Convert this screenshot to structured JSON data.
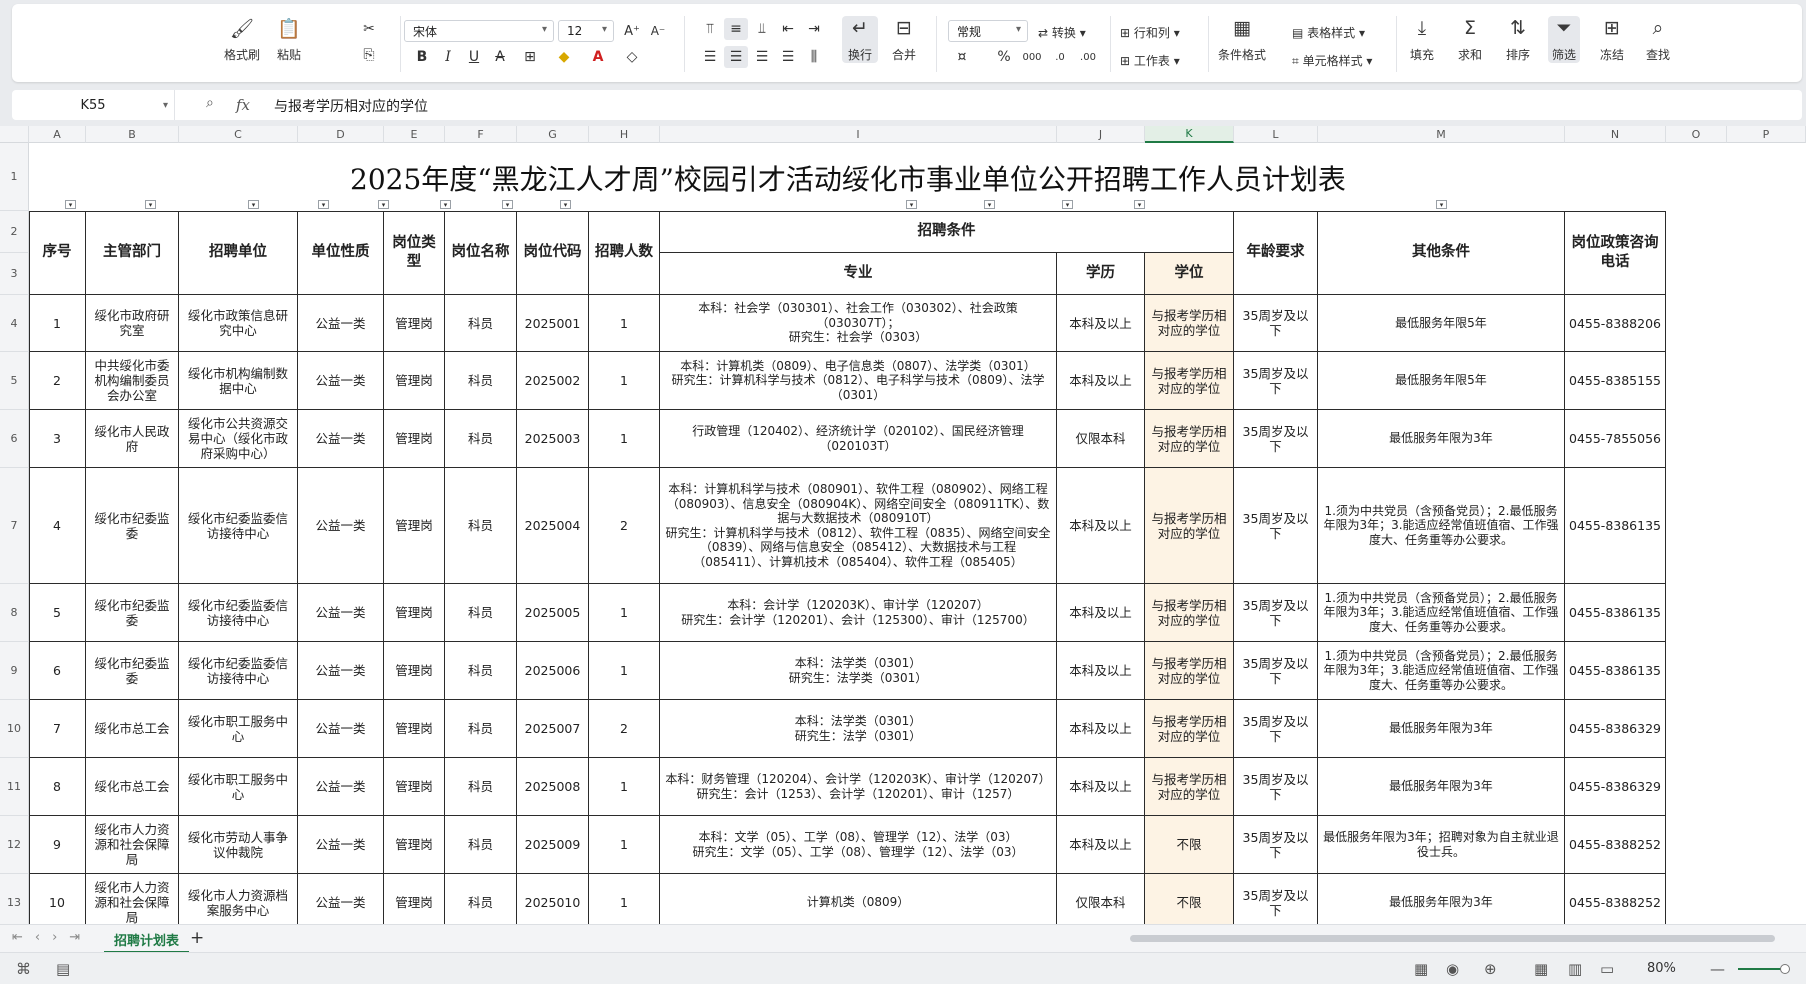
{
  "ribbon": {
    "format_painter": "格式刷",
    "paste": "粘贴",
    "font_name": "宋体",
    "font_size": "12",
    "wrap": "换行",
    "merge": "合并",
    "number_format": "常规",
    "convert": "转换",
    "rows_cols": "行和列",
    "worksheet": "工作表",
    "cond_format": "条件格式",
    "table_style": "表格样式",
    "cell_style": "单元格样式",
    "fill": "填充",
    "sum": "求和",
    "sort": "排序",
    "filter": "筛选",
    "freeze": "冻结",
    "find": "查找"
  },
  "formula_bar": {
    "cell_ref": "K55",
    "fx": "fx",
    "content": "与报考学历相对应的学位"
  },
  "columns": [
    "A",
    "B",
    "C",
    "D",
    "E",
    "F",
    "G",
    "H",
    "I",
    "J",
    "K",
    "L",
    "M",
    "N",
    "O",
    "P"
  ],
  "row_numbers": [
    "1",
    "2",
    "3",
    "4",
    "5",
    "6",
    "7",
    "8",
    "9",
    "10",
    "11",
    "12",
    "13"
  ],
  "title": "2025年度“黑龙江人才周”校园引才活动绥化市事业单位公开招聘工作人员计划表",
  "headers": {
    "seq": "序号",
    "dept": "主管部门",
    "unit": "招聘单位",
    "nature": "单位性质",
    "post_type": "岗位类型",
    "post_name": "岗位名称",
    "post_code": "岗位代码",
    "count": "招聘人数",
    "conditions": "招聘条件",
    "major": "专业",
    "education": "学历",
    "degree": "学位",
    "age": "年龄要求",
    "other": "其他条件",
    "phone": "岗位政策咨询电话"
  },
  "rows": [
    {
      "seq": "1",
      "dept": "绥化市政府研究室",
      "unit": "绥化市政策信息研究中心",
      "nature": "公益一类",
      "type": "管理岗",
      "name": "科员",
      "code": "2025001",
      "count": "1",
      "major": "本科：社会学（030301）、社会工作（030302）、社会政策（030307T）；\n研究生：社会学（0303）",
      "edu": "本科及以上",
      "degree": "与报考学历相对应的学位",
      "age": "35周岁及以下",
      "other": "最低服务年限5年",
      "phone": "0455-8388206"
    },
    {
      "seq": "2",
      "dept": "中共绥化市委机构编制委员会办公室",
      "unit": "绥化市机构编制数据中心",
      "nature": "公益一类",
      "type": "管理岗",
      "name": "科员",
      "code": "2025002",
      "count": "1",
      "major": "本科：计算机类（0809）、电子信息类（0807）、法学类（0301）\n研究生：计算机科学与技术（0812）、电子科学与技术（0809）、法学（0301）",
      "edu": "本科及以上",
      "degree": "与报考学历相对应的学位",
      "age": "35周岁及以下",
      "other": "最低服务年限5年",
      "phone": "0455-8385155"
    },
    {
      "seq": "3",
      "dept": "绥化市人民政府",
      "unit": "绥化市公共资源交易中心（绥化市政府采购中心）",
      "nature": "公益一类",
      "type": "管理岗",
      "name": "科员",
      "code": "2025003",
      "count": "1",
      "major": "行政管理（120402）、经济统计学（020102）、国民经济管理（020103T）",
      "edu": "仅限本科",
      "degree": "与报考学历相对应的学位",
      "age": "35周岁及以下",
      "other": "最低服务年限为3年",
      "phone": "0455-7855056"
    },
    {
      "seq": "4",
      "dept": "绥化市纪委监委",
      "unit": "绥化市纪委监委信访接待中心",
      "nature": "公益一类",
      "type": "管理岗",
      "name": "科员",
      "code": "2025004",
      "count": "2",
      "major": "本科：计算机科学与技术（080901）、软件工程（080902）、网络工程（080903）、信息安全（080904K）、网络空间安全（080911TK）、数据与大数据技术（080910T）\n研究生：计算机科学与技术（0812）、软件工程（0835）、网络空间安全（0839）、网络与信息安全（085412）、大数据技术与工程（085411）、计算机技术（085404）、软件工程（085405）",
      "edu": "本科及以上",
      "degree": "与报考学历相对应的学位",
      "age": "35周岁及以下",
      "other": "1.须为中共党员（含预备党员）；2.最低服务年限为3年；3.能适应经常值班值宿、工作强度大、任务重等办公要求。",
      "phone": "0455-8386135"
    },
    {
      "seq": "5",
      "dept": "绥化市纪委监委",
      "unit": "绥化市纪委监委信访接待中心",
      "nature": "公益一类",
      "type": "管理岗",
      "name": "科员",
      "code": "2025005",
      "count": "1",
      "major": "本科：会计学（120203K）、审计学（120207）\n研究生：会计学（120201）、会计（125300）、审计（125700）",
      "edu": "本科及以上",
      "degree": "与报考学历相对应的学位",
      "age": "35周岁及以下",
      "other": "1.须为中共党员（含预备党员）；2.最低服务年限为3年；3.能适应经常值班值宿、工作强度大、任务重等办公要求。",
      "phone": "0455-8386135"
    },
    {
      "seq": "6",
      "dept": "绥化市纪委监委",
      "unit": "绥化市纪委监委信访接待中心",
      "nature": "公益一类",
      "type": "管理岗",
      "name": "科员",
      "code": "2025006",
      "count": "1",
      "major": "本科：法学类（0301）\n研究生：法学类（0301）",
      "edu": "本科及以上",
      "degree": "与报考学历相对应的学位",
      "age": "35周岁及以下",
      "other": "1.须为中共党员（含预备党员）；2.最低服务年限为3年；3.能适应经常值班值宿、工作强度大、任务重等办公要求。",
      "phone": "0455-8386135"
    },
    {
      "seq": "7",
      "dept": "绥化市总工会",
      "unit": "绥化市职工服务中心",
      "nature": "公益一类",
      "type": "管理岗",
      "name": "科员",
      "code": "2025007",
      "count": "2",
      "major": "本科：法学类（0301）\n研究生：法学（0301）",
      "edu": "本科及以上",
      "degree": "与报考学历相对应的学位",
      "age": "35周岁及以下",
      "other": "最低服务年限为3年",
      "phone": "0455-8386329"
    },
    {
      "seq": "8",
      "dept": "绥化市总工会",
      "unit": "绥化市职工服务中心",
      "nature": "公益一类",
      "type": "管理岗",
      "name": "科员",
      "code": "2025008",
      "count": "1",
      "major": "本科：财务管理（120204）、会计学（120203K）、审计学（120207）\n研究生：会计（1253）、会计学（120201）、审计（1257）",
      "edu": "本科及以上",
      "degree": "与报考学历相对应的学位",
      "age": "35周岁及以下",
      "other": "最低服务年限为3年",
      "phone": "0455-8386329"
    },
    {
      "seq": "9",
      "dept": "绥化市人力资源和社会保障局",
      "unit": "绥化市劳动人事争议仲裁院",
      "nature": "公益一类",
      "type": "管理岗",
      "name": "科员",
      "code": "2025009",
      "count": "1",
      "major": "本科：文学（05）、工学（08）、管理学（12）、法学（03）\n研究生：文学（05）、工学（08）、管理学（12）、法学（03）",
      "edu": "本科及以上",
      "degree": "不限",
      "age": "35周岁及以下",
      "other": "最低服务年限为3年；招聘对象为自主就业退役士兵。",
      "phone": "0455-8388252"
    },
    {
      "seq": "10",
      "dept": "绥化市人力资源和社会保障局",
      "unit": "绥化市人力资源档案服务中心",
      "nature": "公益一类",
      "type": "管理岗",
      "name": "科员",
      "code": "2025010",
      "count": "1",
      "major": "计算机类（0809）",
      "edu": "仅限本科",
      "degree": "不限",
      "age": "35周岁及以下",
      "other": "最低服务年限为3年",
      "phone": "0455-8388252"
    }
  ],
  "sheet_tab": "招聘计划表",
  "status": {
    "zoom": "80%"
  },
  "colors": {
    "accent": "#1f7a45",
    "highlight_column": "#fdf3e4"
  }
}
